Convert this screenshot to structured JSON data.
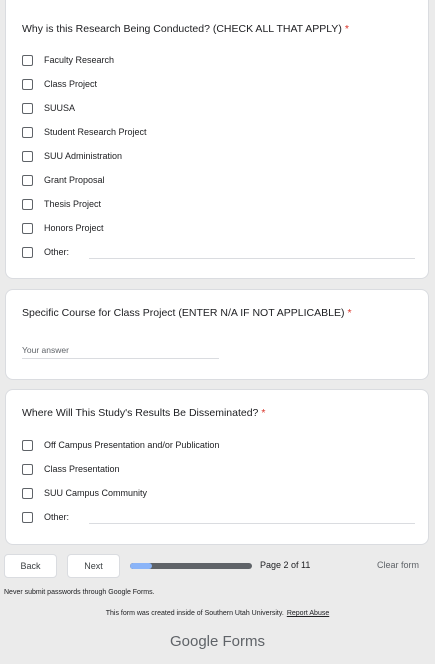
{
  "question1": {
    "title": "Why is this Research Being Conducted? (CHECK ALL THAT APPLY)",
    "required_mark": "*",
    "options": [
      {
        "label": "Faculty Research",
        "checked": false
      },
      {
        "label": "Class Project",
        "checked": false
      },
      {
        "label": "SUUSA",
        "checked": false
      },
      {
        "label": "Student Research Project",
        "checked": false
      },
      {
        "label": "SUU Administration",
        "checked": false
      },
      {
        "label": "Grant Proposal",
        "checked": false
      },
      {
        "label": "Thesis Project",
        "checked": false
      },
      {
        "label": "Honors Project",
        "checked": false
      },
      {
        "label": "Other:",
        "checked": false
      }
    ]
  },
  "question2": {
    "title": "Specific Course for Class Project (ENTER N/A IF NOT APPLICABLE)",
    "required_mark": "*",
    "placeholder": "Your answer"
  },
  "question3": {
    "title": "Where Will This Study's Results Be Disseminated?",
    "required_mark": "*",
    "options": [
      {
        "label": "Off Campus Presentation and/or Publication",
        "checked": false
      },
      {
        "label": "Class Presentation",
        "checked": false
      },
      {
        "label": "SUU Campus Community",
        "checked": false
      },
      {
        "label": "Other:",
        "checked": false
      }
    ]
  },
  "nav": {
    "back_label": "Back",
    "next_label": "Next",
    "progress_fraction": 0.1818,
    "page_text": "Page 2 of 11",
    "clear_label": "Clear form"
  },
  "footer": {
    "warning": "Never submit passwords through Google Forms.",
    "created_text": "This form was created inside of Southern Utah University.",
    "report_label": "Report Abuse",
    "brand": "Google Forms"
  },
  "colors": {
    "required": "#d93025",
    "progress_fill": "#8ab4f8",
    "progress_track": "#5f6368",
    "page_background": "#ebebeb"
  },
  "icons": {
    "checkbox": "checkbox-empty-icon"
  }
}
